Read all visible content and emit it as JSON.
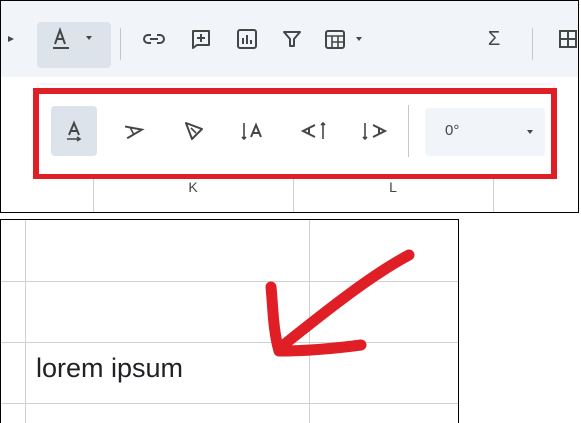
{
  "toolbar": {
    "icons": [
      "arrow-left-icon",
      "text-color-icon",
      "dropdown-caret-icon",
      "link-icon",
      "insert-comment-icon",
      "insert-chart-icon",
      "filter-icon",
      "filter-views-icon",
      "dropdown-caret-icon",
      "functions-icon",
      "more-icon"
    ],
    "functions_label": "Σ"
  },
  "text_rotation": {
    "options": [
      "none",
      "tilt-up",
      "tilt-down",
      "stack-vertically",
      "rotate-up",
      "rotate-down"
    ],
    "selected": "none",
    "angle_value": "0°"
  },
  "column_headers": [
    "K",
    "L"
  ],
  "sheet": {
    "cell_text": "lorem ipsum"
  },
  "annotation": {
    "highlight_color": "#e01e26",
    "arrow_color": "#e01e26"
  }
}
